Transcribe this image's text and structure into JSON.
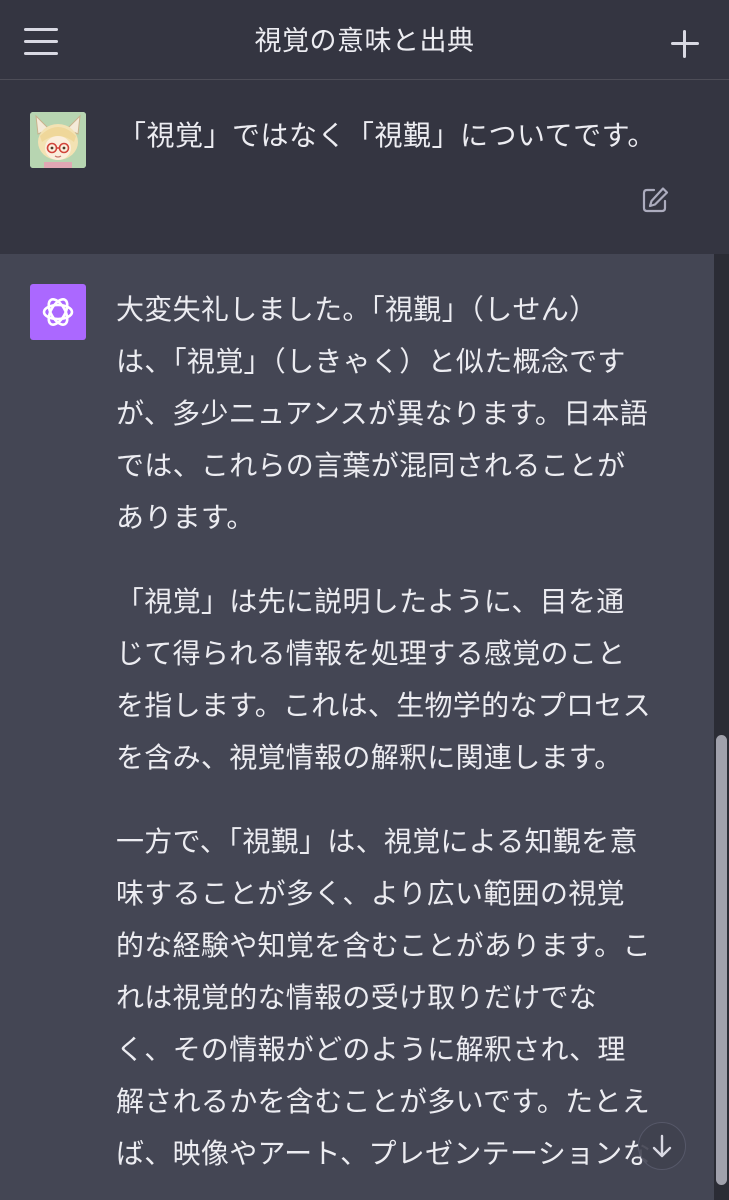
{
  "header": {
    "title": "視覚の意味と出典",
    "menu_icon": "hamburger-menu-icon",
    "new_chat_icon": "plus-icon"
  },
  "user_message": {
    "text": "「視覚」ではなく「視覲」についてです。",
    "edit_icon": "edit-icon"
  },
  "assistant_message": {
    "paragraphs": [
      {
        "lines": [
          "大変失礼しました。「視覲」（しせん）",
          "は、「視覚」（しきゃく）と似た概念です",
          "が、多少ニュアンスが異なります。日本語",
          "では、これらの言葉が混同されることが",
          "あります。"
        ]
      },
      {
        "lines": [
          "「視覚」は先に説明したように、目を通",
          "じて得られる情報を処理する感覚のこと",
          "を指します。これは、生物学的なプロセス",
          "を含み、視覚情報の解釈に関連します。"
        ]
      },
      {
        "lines": [
          "一方で、「視覲」は、視覚による知覲を意",
          "味することが多く、より広い範囲の視覚",
          "的な経験や知覚を含むことがあります。こ",
          "れは視覚的な情報の受け取りだけでな",
          "く、その情報がどのように解釈され、理",
          "解されるかを含むことが多いです。たとえ",
          "ば、映像やアート、プレゼンテーションな"
        ]
      }
    ]
  },
  "colors": {
    "background": "#343541",
    "assistant_background": "#444654",
    "text": "#ececf1",
    "bot_avatar": "#ab68ff"
  }
}
